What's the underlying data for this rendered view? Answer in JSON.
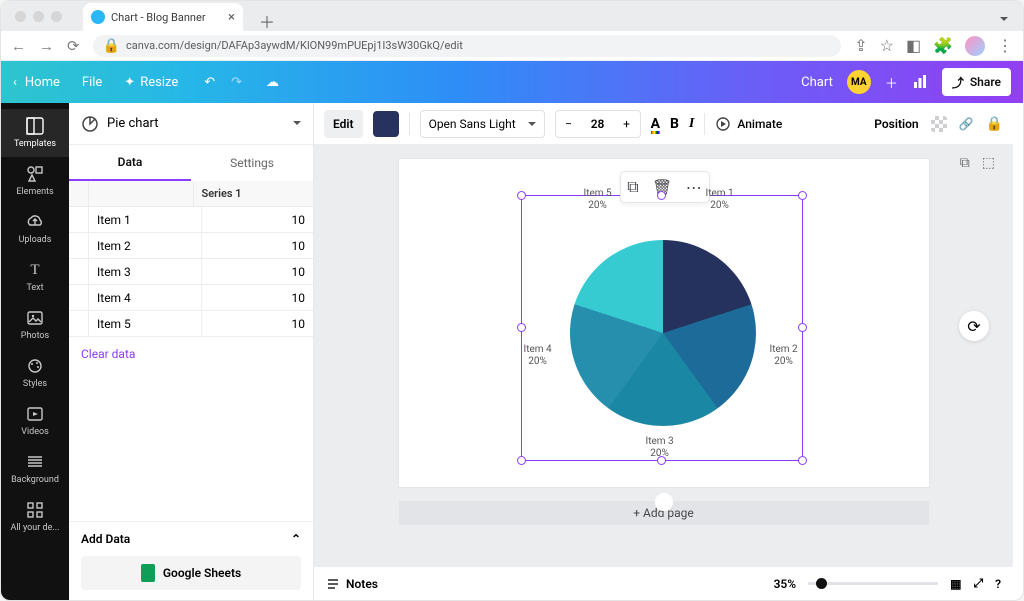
{
  "browser": {
    "tab_title": "Chart - Blog Banner",
    "url": "canva.com/design/DAFAp3aywdM/KlON99mPUEpj1I3sW30GkQ/edit"
  },
  "header": {
    "home": "Home",
    "file": "File",
    "resize": "Resize",
    "doc_title": "Chart",
    "avatar_initials": "MA",
    "share": "Share"
  },
  "left_sidebar": {
    "items": [
      "Templates",
      "Elements",
      "Uploads",
      "Text",
      "Photos",
      "Styles",
      "Videos",
      "Background",
      "All your de..."
    ]
  },
  "side_panel": {
    "chart_type": "Pie chart",
    "tabs": {
      "data": "Data",
      "settings": "Settings"
    },
    "series_header": "Series 1",
    "rows": [
      {
        "label": "Item 1",
        "value": "10"
      },
      {
        "label": "Item 2",
        "value": "10"
      },
      {
        "label": "Item 3",
        "value": "10"
      },
      {
        "label": "Item 4",
        "value": "10"
      },
      {
        "label": "Item 5",
        "value": "10"
      }
    ],
    "clear": "Clear data",
    "add_data": "Add Data",
    "google_sheets": "Google Sheets"
  },
  "toolbar": {
    "edit": "Edit",
    "font": "Open Sans Light",
    "size": "28",
    "bold": "B",
    "italic": "I",
    "color": "A",
    "animate": "Animate",
    "position": "Position"
  },
  "canvas": {
    "labels": {
      "i1": "Item 1",
      "i2": "Item 2",
      "i3": "Item 3",
      "i4": "Item 4",
      "i5": "Item 5",
      "pct": "20%"
    },
    "add_page": "+ Add page"
  },
  "bottom": {
    "notes": "Notes",
    "zoom": "35%"
  },
  "chart_data": {
    "type": "pie",
    "title": "",
    "categories": [
      "Item 1",
      "Item 2",
      "Item 3",
      "Item 4",
      "Item 5"
    ],
    "values": [
      10,
      10,
      10,
      10,
      10
    ],
    "percentages": [
      20,
      20,
      20,
      20,
      20
    ],
    "colors": [
      "#26325e",
      "#1d6b99",
      "#1a87a4",
      "#258fad",
      "#35cbd1"
    ]
  }
}
